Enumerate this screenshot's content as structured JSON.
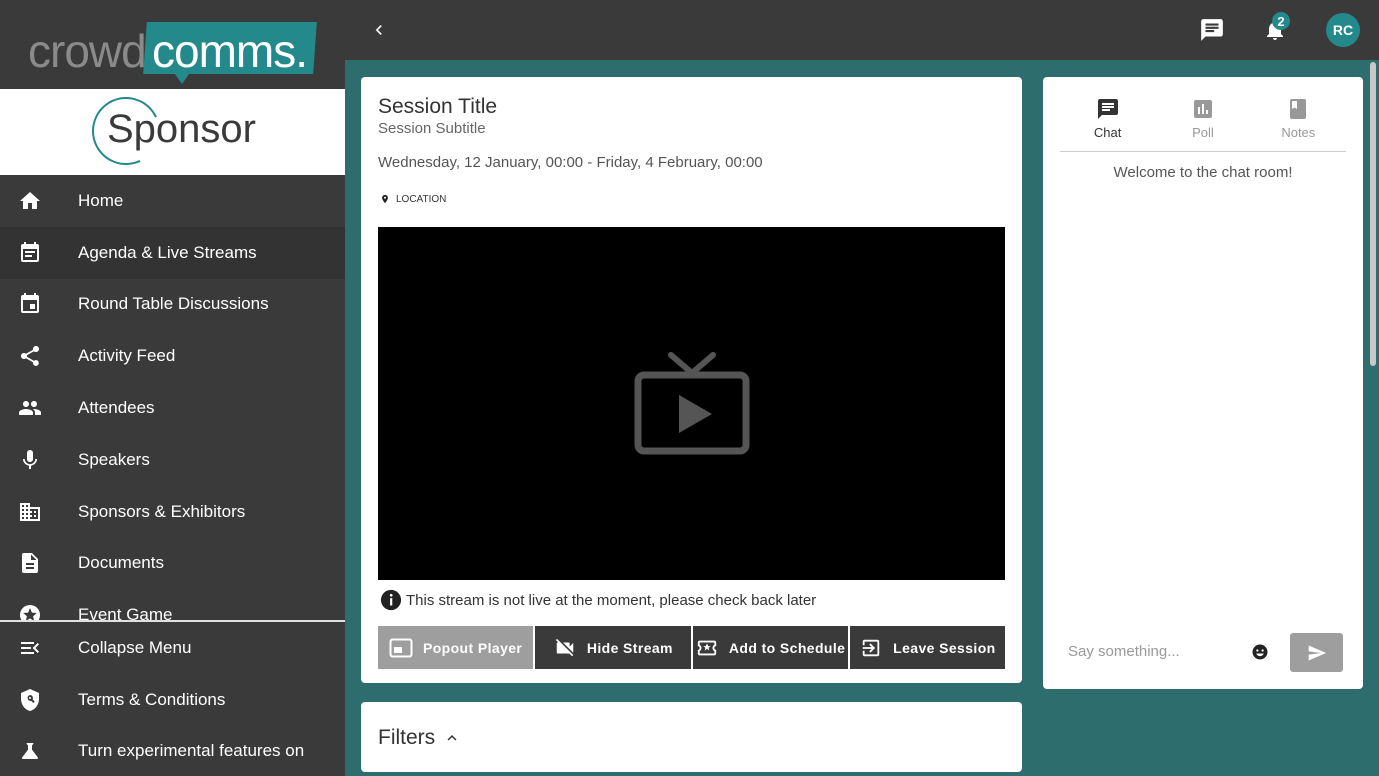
{
  "brand": {
    "crowd": "crowd",
    "comms": "comms.",
    "sponsor": "Sponsor"
  },
  "topbar": {
    "notification_count": "2",
    "avatar_initials": "RC"
  },
  "sidebar": {
    "items": [
      {
        "label": "Home",
        "icon": "home-icon"
      },
      {
        "label": "Agenda & Live Streams",
        "icon": "agenda-icon"
      },
      {
        "label": "Round Table Discussions",
        "icon": "calendar-icon"
      },
      {
        "label": "Activity Feed",
        "icon": "share-icon"
      },
      {
        "label": "Attendees",
        "icon": "people-icon"
      },
      {
        "label": "Speakers",
        "icon": "microphone-icon"
      },
      {
        "label": "Sponsors & Exhibitors",
        "icon": "building-icon"
      },
      {
        "label": "Documents",
        "icon": "document-icon"
      },
      {
        "label": "Event Game",
        "icon": "star-icon"
      }
    ],
    "bottom": [
      {
        "label": "Collapse Menu",
        "icon": "collapse-icon"
      },
      {
        "label": "Terms & Conditions",
        "icon": "shield-icon"
      },
      {
        "label": "Turn experimental features on",
        "icon": "flask-icon"
      }
    ]
  },
  "session": {
    "title": "Session Title",
    "subtitle": "Session Subtitle",
    "dates": "Wednesday, 12 January, 00:00 - Friday, 4 February, 00:00",
    "location": "LOCATION",
    "notice": "This stream is not live at the moment, please check back later",
    "buttons": {
      "popout": "Popout Player",
      "hide": "Hide Stream",
      "schedule": "Add to Schedule",
      "leave": "Leave Session"
    }
  },
  "filters": {
    "label": "Filters"
  },
  "chat": {
    "tabs": {
      "chat": "Chat",
      "poll": "Poll",
      "notes": "Notes"
    },
    "welcome": "Welcome to the chat room!",
    "placeholder": "Say something..."
  },
  "colors": {
    "accent": "#23898a",
    "sidebar": "#3a3a3a",
    "background": "#2d6d6d"
  }
}
